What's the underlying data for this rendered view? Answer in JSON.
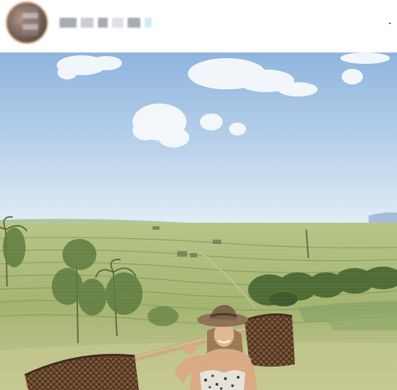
{
  "post": {
    "author_name_blurred": true,
    "more_icon": "more-dots-icon",
    "more_glyph": "·"
  },
  "photo": {
    "scene": "rice-terraces",
    "colors": {
      "sky_top": "#8fb6df",
      "sky_bottom": "#dce9f3",
      "field": "#a9b974",
      "terrace_dark": "#6f8a4a",
      "basket": "#6b4a2f"
    }
  }
}
